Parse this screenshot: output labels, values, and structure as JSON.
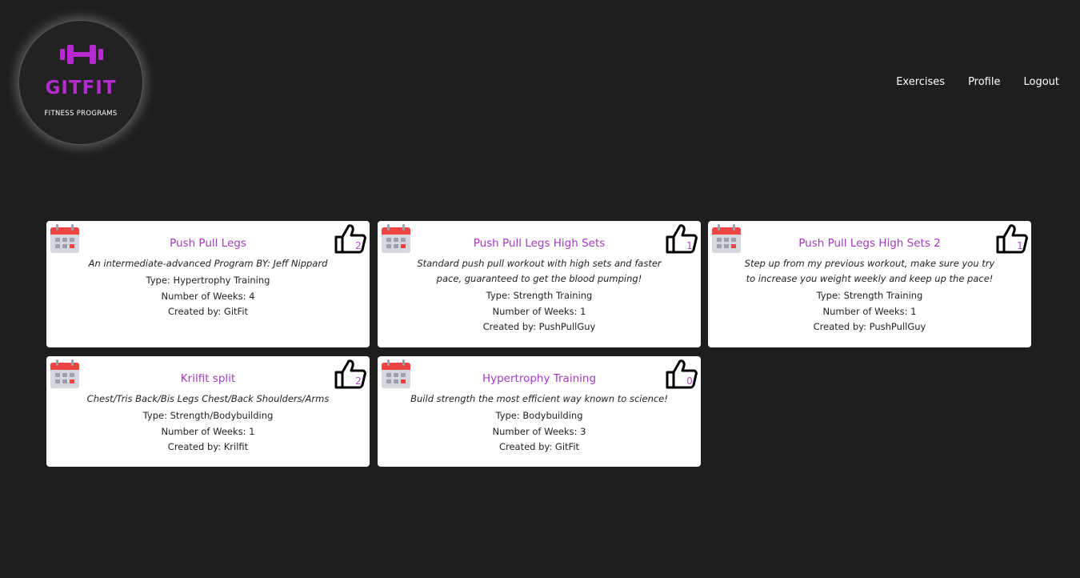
{
  "logo": {
    "brand": "GITFIT",
    "tagline": "FITNESS PROGRAMS",
    "icon": "dumbbell-icon",
    "accent": "#b52ad0"
  },
  "nav": {
    "items": [
      {
        "label": "Exercises"
      },
      {
        "label": "Profile"
      },
      {
        "label": "Logout"
      }
    ]
  },
  "programs": [
    {
      "title": "Push Pull Legs",
      "description": "An intermediate-advanced Program BY: Jeff Nippard",
      "type": "Type: Hypertrophy Training",
      "weeks": "Number of Weeks: 4",
      "creator": "Created by: GitFit",
      "likes": "2"
    },
    {
      "title": "Push Pull Legs High Sets",
      "description": "Standard push pull workout with high sets and faster pace, guaranteed to get the blood pumping!",
      "type": "Type: Strength Training",
      "weeks": "Number of Weeks: 1",
      "creator": "Created by: PushPullGuy",
      "likes": "1"
    },
    {
      "title": "Push Pull Legs High Sets 2",
      "description": "Step up from my previous workout, make sure you try to increase you weight weekly and keep up the pace!",
      "type": "Type: Strength Training",
      "weeks": "Number of Weeks: 1",
      "creator": "Created by: PushPullGuy",
      "likes": "1"
    },
    {
      "title": "Krilfit split",
      "description": "Chest/Tris Back/Bis Legs Chest/Back Shoulders/Arms",
      "type": "Type: Strength/Bodybuilding",
      "weeks": "Number of Weeks: 1",
      "creator": "Created by: Krilfit",
      "likes": "2"
    },
    {
      "title": "Hypertrophy Training",
      "description": "Build strength the most efficient way known to science!",
      "type": "Type: Bodybuilding",
      "weeks": "Number of Weeks: 3",
      "creator": "Created by: GitFit",
      "likes": "0"
    }
  ]
}
